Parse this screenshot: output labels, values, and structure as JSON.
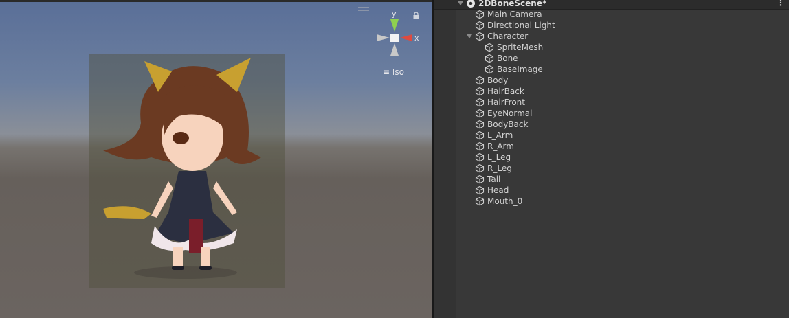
{
  "scene_view": {
    "gizmo": {
      "y_label": "y",
      "x_label": "x",
      "y_color": "#8fd14f",
      "x_color": "#e04a3f"
    },
    "projection_label": "Iso",
    "lock_icon": "lock-icon"
  },
  "hierarchy": {
    "scene_name": "2DBoneScene*",
    "items": [
      {
        "label": "Main Camera",
        "depth": 1
      },
      {
        "label": "Directional Light",
        "depth": 1
      },
      {
        "label": "Character",
        "depth": 1,
        "expanded": true
      },
      {
        "label": "SpriteMesh",
        "depth": 2
      },
      {
        "label": "Bone",
        "depth": 2
      },
      {
        "label": "BaseImage",
        "depth": 2
      },
      {
        "label": "Body",
        "depth": 1
      },
      {
        "label": "HairBack",
        "depth": 1
      },
      {
        "label": "HairFront",
        "depth": 1
      },
      {
        "label": "EyeNormal",
        "depth": 1
      },
      {
        "label": "BodyBack",
        "depth": 1
      },
      {
        "label": "L_Arm",
        "depth": 1
      },
      {
        "label": "R_Arm",
        "depth": 1
      },
      {
        "label": "L_Leg",
        "depth": 1
      },
      {
        "label": "R_Leg",
        "depth": 1
      },
      {
        "label": "Tail",
        "depth": 1
      },
      {
        "label": "Head",
        "depth": 1
      },
      {
        "label": "Mouth_0",
        "depth": 1
      }
    ]
  }
}
